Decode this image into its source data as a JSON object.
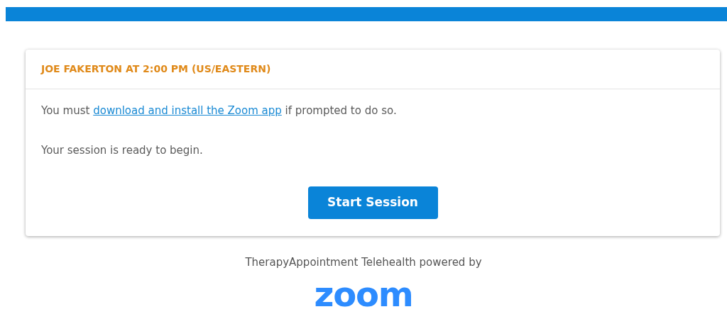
{
  "appointment": {
    "title": "JOE FAKERTON AT 2:00 PM (US/EASTERN)",
    "message_parts": [
      {
        "kind": "text",
        "text": "You must "
      },
      {
        "kind": "link",
        "text": "download and install the Zoom app"
      },
      {
        "kind": "text",
        "text": " if prompted to do so."
      }
    ],
    "status": "Your session is ready to begin.",
    "button": "Start Session"
  },
  "footer": {
    "text": "TherapyAppointment Telehealth powered by",
    "logo": "zoom"
  }
}
